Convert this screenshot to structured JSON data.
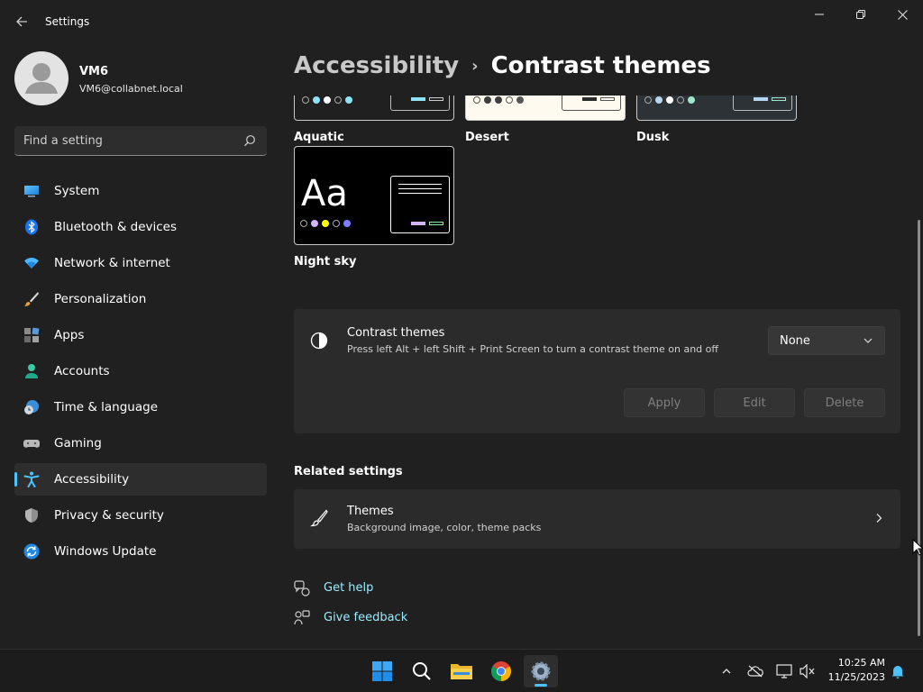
{
  "window": {
    "app_title": "Settings"
  },
  "user": {
    "name": "VM6",
    "email": "VM6@collabnet.local"
  },
  "search": {
    "placeholder": "Find a setting"
  },
  "sidebar": {
    "items": [
      {
        "label": "System",
        "icon": "system-icon"
      },
      {
        "label": "Bluetooth & devices",
        "icon": "bluetooth-icon"
      },
      {
        "label": "Network & internet",
        "icon": "network-icon"
      },
      {
        "label": "Personalization",
        "icon": "brush-icon"
      },
      {
        "label": "Apps",
        "icon": "apps-icon"
      },
      {
        "label": "Accounts",
        "icon": "accounts-icon"
      },
      {
        "label": "Time & language",
        "icon": "time-language-icon"
      },
      {
        "label": "Gaming",
        "icon": "gaming-icon"
      },
      {
        "label": "Accessibility",
        "icon": "accessibility-icon",
        "active": true
      },
      {
        "label": "Privacy & security",
        "icon": "shield-icon"
      },
      {
        "label": "Windows Update",
        "icon": "update-icon"
      }
    ]
  },
  "header": {
    "parent": "Accessibility",
    "separator": "›",
    "current": "Contrast themes"
  },
  "themes": {
    "aquatic": "Aquatic",
    "desert": "Desert",
    "dusk": "Dusk",
    "night_sky": "Night sky",
    "preview_glyph": "Aa"
  },
  "contrast_card": {
    "title": "Contrast themes",
    "description": "Press left Alt + left Shift + Print Screen to turn a contrast theme on and off",
    "selected": "None",
    "apply": "Apply",
    "edit": "Edit",
    "delete": "Delete"
  },
  "related": {
    "title": "Related settings",
    "themes_title": "Themes",
    "themes_desc": "Background image, color, theme packs"
  },
  "links": {
    "help": "Get help",
    "feedback": "Give feedback"
  },
  "taskbar": {
    "time": "10:25 AM",
    "date": "11/25/2023"
  },
  "colors": {
    "accent": "#4cc2ff",
    "link": "#99ebff",
    "background": "#202020",
    "card": "#2b2b2b"
  }
}
